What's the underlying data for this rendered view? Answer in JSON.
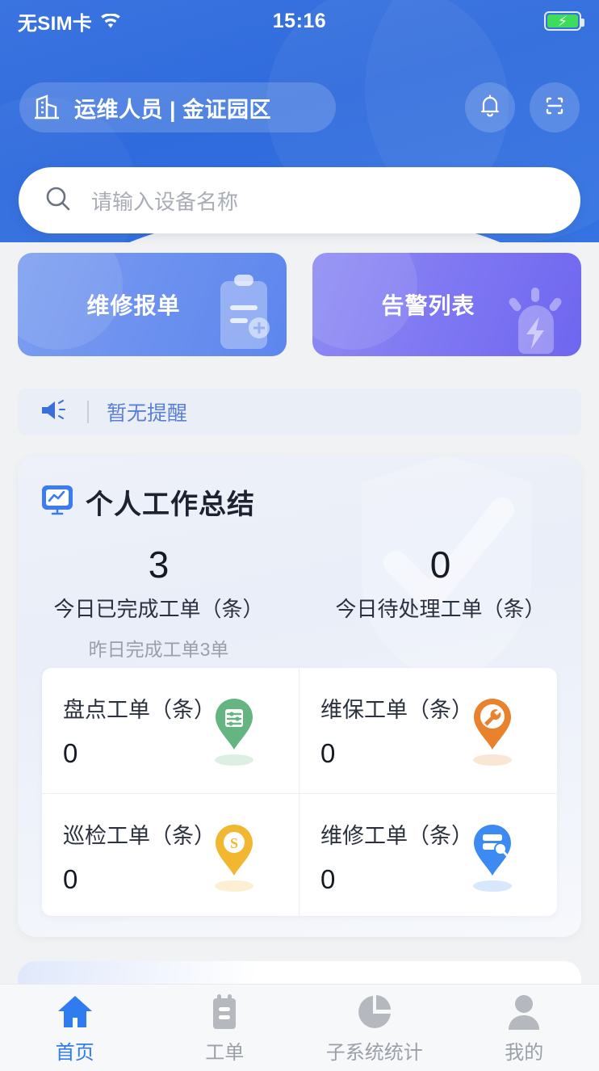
{
  "status_bar": {
    "carrier": "无SIM卡",
    "wifi_icon": "wifi-icon",
    "time": "15:16",
    "battery_icon": "battery-charging-icon"
  },
  "header": {
    "org_icon": "building-icon",
    "org_text": "运维人员 | 金证园区",
    "notification_icon": "bell-icon",
    "scan_icon": "scan-qr-icon",
    "accent_color": "#2f6bdd"
  },
  "search": {
    "icon": "search-icon",
    "placeholder": "请输入设备名称",
    "value": ""
  },
  "quick_actions": [
    {
      "label": "维修报单",
      "icon": "clipboard-icon",
      "color": "#6f93ef"
    },
    {
      "label": "告警列表",
      "icon": "alarm-light-icon",
      "color": "#8079f2"
    }
  ],
  "notice": {
    "icon": "speaker-icon",
    "text": "暂无提醒",
    "text_color": "#5b7fd4"
  },
  "summary": {
    "icon": "chart-monitor-icon",
    "title": "个人工作总结",
    "stats": [
      {
        "value": "3",
        "label": "今日已完成工单（条）",
        "sub": "昨日完成工单3单"
      },
      {
        "value": "0",
        "label": "今日待处理工单（条）",
        "sub": ""
      }
    ],
    "cells": [
      {
        "label": "盘点工单（条）",
        "value": "0",
        "icon": "pin-inventory-icon",
        "color": "#64b581"
      },
      {
        "label": "维保工单（条）",
        "value": "0",
        "icon": "pin-wrench-icon",
        "color": "#e8822c"
      },
      {
        "label": "巡检工单（条）",
        "value": "0",
        "icon": "pin-patrol-icon",
        "color": "#f2b731"
      },
      {
        "label": "维修工单（条）",
        "value": "0",
        "icon": "pin-repair-icon",
        "color": "#3d8bf2"
      }
    ]
  },
  "tabbar": {
    "active_index": 0,
    "active_color": "#2f7bf0",
    "inactive_color": "#9b9fa8",
    "items": [
      {
        "label": "首页",
        "icon": "home-icon"
      },
      {
        "label": "工单",
        "icon": "clipboard-list-icon"
      },
      {
        "label": "子系统统计",
        "icon": "pie-chart-icon"
      },
      {
        "label": "我的",
        "icon": "person-icon"
      }
    ]
  }
}
